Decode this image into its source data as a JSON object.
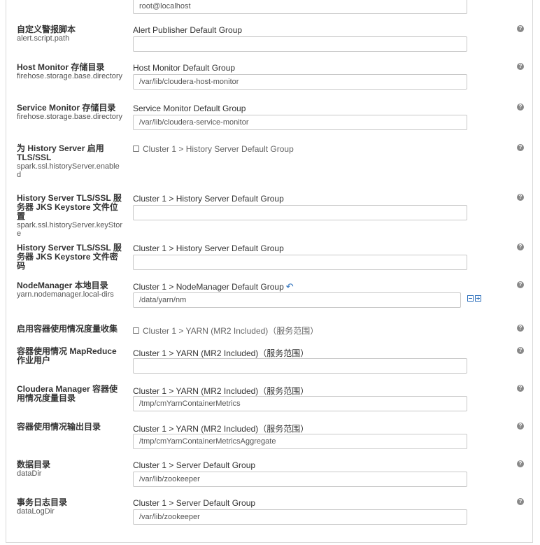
{
  "help_glyph": "?",
  "undo_glyph": "↶",
  "top_input": {
    "value": "root@localhost"
  },
  "rows": [
    {
      "label": "自定义警报脚本",
      "key": "alert.script.path",
      "group": "Alert Publisher Default Group",
      "value": ""
    },
    {
      "label": "Host Monitor 存储目录",
      "key": "firehose.storage.base.directory",
      "group": "Host Monitor Default Group",
      "value": "/var/lib/cloudera-host-monitor"
    },
    {
      "label": "Service Monitor 存储目录",
      "key": "firehose.storage.base.directory",
      "group": "Service Monitor Default Group",
      "value": "/var/lib/cloudera-service-monitor"
    },
    {
      "label": "为 History Server 启用 TLS/SSL",
      "key": "spark.ssl.historyServer.enabled",
      "group": "Cluster 1 > History Server Default Group"
    },
    {
      "label": "History Server TLS/SSL 服务器 JKS Keystore 文件位置",
      "key": "spark.ssl.historyServer.keyStore",
      "group": "Cluster 1 > History Server Default Group",
      "value": ""
    },
    {
      "label": "History Server TLS/SSL 服务器 JKS Keystore 文件密码",
      "key": "",
      "group": "Cluster 1 > History Server Default Group",
      "value": ""
    },
    {
      "label": "NodeManager 本地目录",
      "key": "yarn.nodemanager.local-dirs",
      "group": "Cluster 1 > NodeManager Default Group",
      "value": "/data/yarn/nm"
    },
    {
      "label": "启用容器使用情况度量收集",
      "key": "",
      "group": "Cluster 1 > YARN (MR2 Included)（服务范围）"
    },
    {
      "label": "容器使用情况 MapReduce 作业用户",
      "key": "",
      "group": "Cluster 1 > YARN (MR2 Included)（服务范围）",
      "value": ""
    },
    {
      "label": "Cloudera Manager 容器使用情况度量目录",
      "key": "",
      "group": "Cluster 1 > YARN (MR2 Included)（服务范围）",
      "value": "/tmp/cmYarnContainerMetrics"
    },
    {
      "label": "容器使用情况输出目录",
      "key": "",
      "group": "Cluster 1 > YARN (MR2 Included)（服务范围）",
      "value": "/tmp/cmYarnContainerMetricsAggregate"
    },
    {
      "label": "数据目录",
      "key": "dataDir",
      "group": "Cluster 1 > Server Default Group",
      "value": "/var/lib/zookeeper"
    },
    {
      "label": "事务日志目录",
      "key": "dataLogDir",
      "group": "Cluster 1 > Server Default Group",
      "value": "/var/lib/zookeeper"
    }
  ]
}
